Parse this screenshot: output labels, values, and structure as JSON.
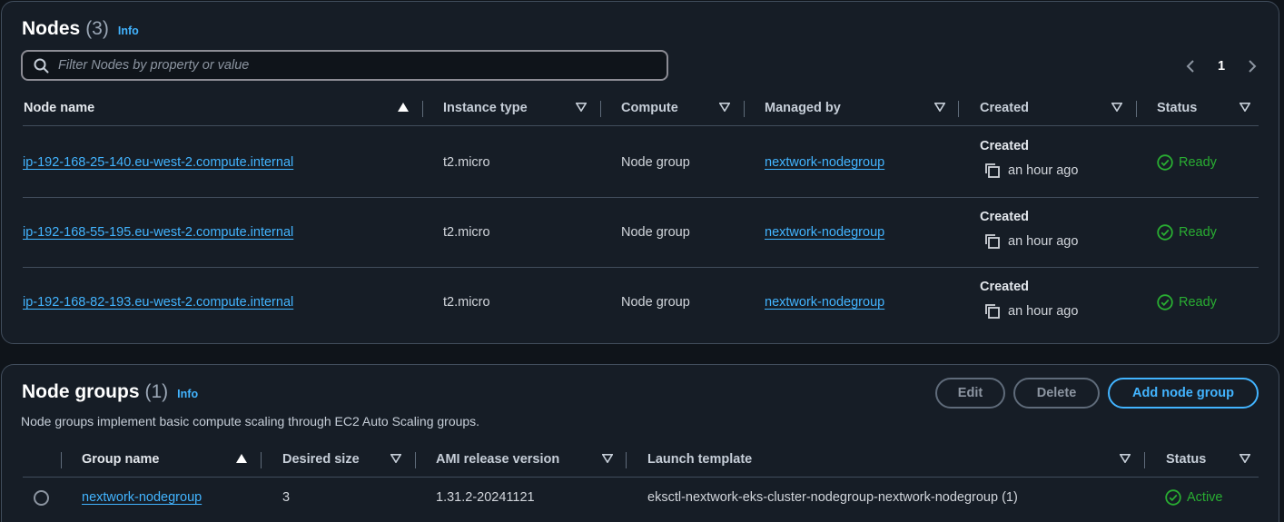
{
  "nodes": {
    "title": "Nodes",
    "count": "(3)",
    "info": "Info",
    "filter_placeholder": "Filter Nodes by property or value",
    "page_number": "1",
    "columns": [
      "Node name",
      "Instance type",
      "Compute",
      "Managed by",
      "Created",
      "Status"
    ],
    "rows": [
      {
        "name": "ip-192-168-25-140.eu-west-2.compute.internal",
        "instance_type": "t2.micro",
        "compute": "Node group",
        "managed_by": "nextwork-nodegroup",
        "created_label": "Created",
        "created_value": "an hour ago",
        "status": "Ready"
      },
      {
        "name": "ip-192-168-55-195.eu-west-2.compute.internal",
        "instance_type": "t2.micro",
        "compute": "Node group",
        "managed_by": "nextwork-nodegroup",
        "created_label": "Created",
        "created_value": "an hour ago",
        "status": "Ready"
      },
      {
        "name": "ip-192-168-82-193.eu-west-2.compute.internal",
        "instance_type": "t2.micro",
        "compute": "Node group",
        "managed_by": "nextwork-nodegroup",
        "created_label": "Created",
        "created_value": "an hour ago",
        "status": "Ready"
      }
    ]
  },
  "node_groups": {
    "title": "Node groups",
    "count": "(1)",
    "info": "Info",
    "description": "Node groups implement basic compute scaling through EC2 Auto Scaling groups.",
    "buttons": {
      "edit": "Edit",
      "delete": "Delete",
      "add": "Add node group"
    },
    "columns": [
      "Group name",
      "Desired size",
      "AMI release version",
      "Launch template",
      "Status"
    ],
    "rows": [
      {
        "name": "nextwork-nodegroup",
        "desired_size": "3",
        "ami_release_version": "1.31.2-20241121",
        "launch_template": "eksctl-nextwork-eks-cluster-nodegroup-nextwork-nodegroup (1)",
        "status": "Active"
      }
    ]
  },
  "colors": {
    "background": "#0f141a",
    "panel": "#161d26",
    "link": "#42b4ff",
    "success": "#29ad32",
    "border": "#414d5c"
  },
  "icons": [
    "search-icon",
    "chevron-left-icon",
    "chevron-right-icon",
    "sort-ascending-icon",
    "sort-icon",
    "copy-icon",
    "status-check-icon"
  ]
}
